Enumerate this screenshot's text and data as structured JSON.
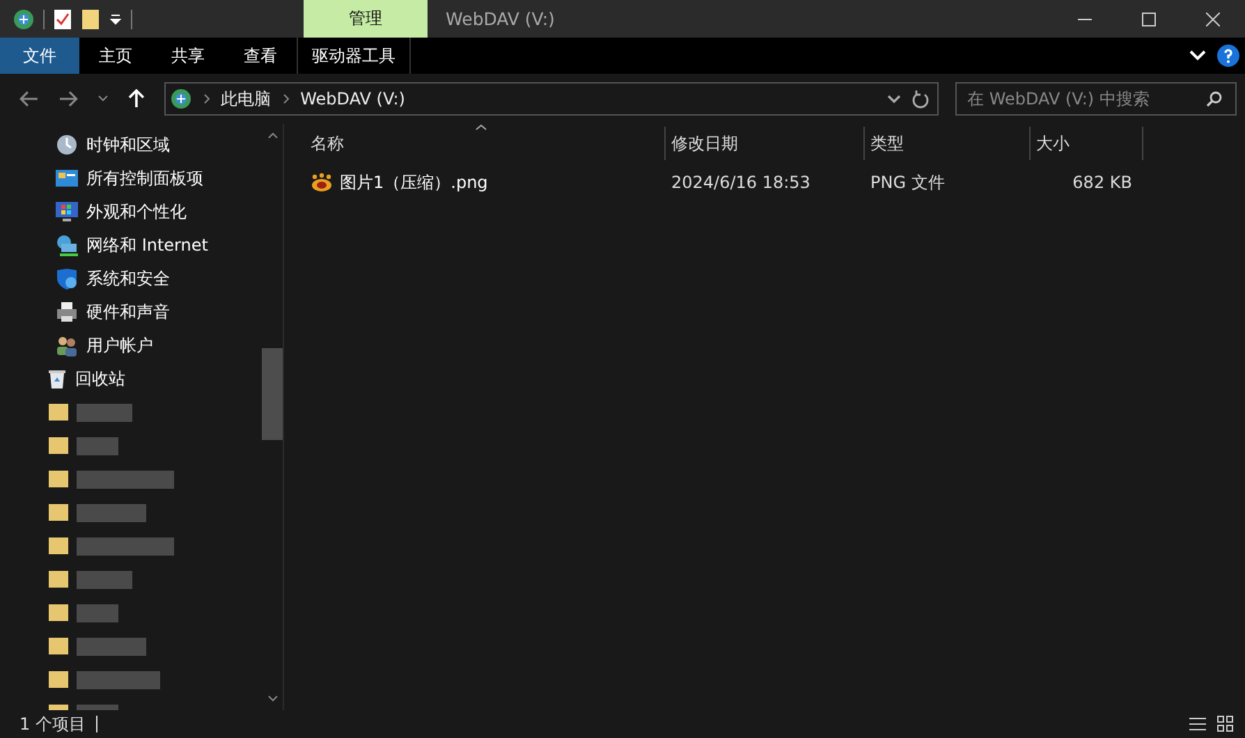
{
  "window": {
    "title": "WebDAV (V:)",
    "context_tab": "管理"
  },
  "ribbon_tabs": [
    {
      "label": "文件",
      "kind": "file"
    },
    {
      "label": "主页",
      "kind": "tab"
    },
    {
      "label": "共享",
      "kind": "tab"
    },
    {
      "label": "查看",
      "kind": "tab"
    },
    {
      "label": "驱动器工具",
      "kind": "context"
    }
  ],
  "address": {
    "crumbs": [
      "此电脑",
      "WebDAV (V:)"
    ],
    "search_placeholder": "在 WebDAV (V:) 中搜索"
  },
  "sidebar": {
    "items": [
      {
        "kind": "clock",
        "label": "时钟和区域"
      },
      {
        "kind": "panel",
        "label": "所有控制面板项"
      },
      {
        "kind": "display",
        "label": "外观和个性化"
      },
      {
        "kind": "network",
        "label": "网络和 Internet"
      },
      {
        "kind": "shield",
        "label": "系统和安全"
      },
      {
        "kind": "printer",
        "label": "硬件和声音"
      },
      {
        "kind": "users",
        "label": "用户帐户"
      },
      {
        "kind": "recycle",
        "label": "回收站"
      },
      {
        "kind": "redacted"
      },
      {
        "kind": "redacted"
      },
      {
        "kind": "redacted"
      },
      {
        "kind": "redacted"
      },
      {
        "kind": "redacted"
      },
      {
        "kind": "redacted"
      },
      {
        "kind": "redacted"
      },
      {
        "kind": "redacted"
      },
      {
        "kind": "redacted"
      },
      {
        "kind": "redacted"
      }
    ]
  },
  "table": {
    "columns": [
      "名称",
      "修改日期",
      "类型",
      "大小"
    ],
    "rows": [
      {
        "name": "图片1（压缩）.png",
        "date": "2024/6/16 18:53",
        "type": "PNG 文件",
        "size": "682 KB"
      }
    ]
  },
  "status_bar": {
    "count": "1 个项目"
  }
}
